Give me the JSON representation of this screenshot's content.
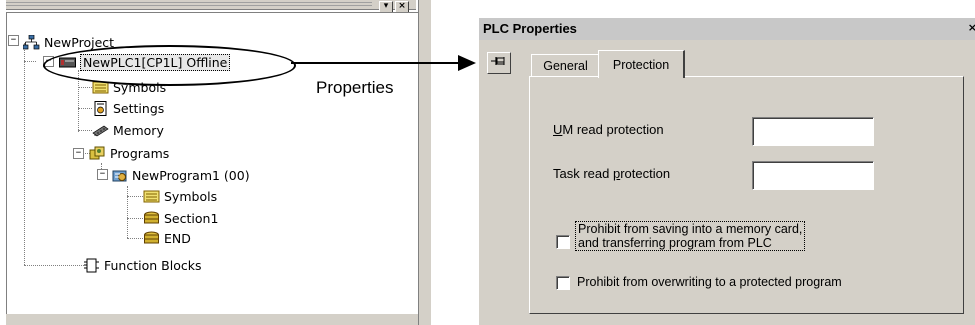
{
  "tree": {
    "items": [
      {
        "label": "NewProject"
      },
      {
        "label": "NewPLC1[CP1L] Offline"
      },
      {
        "label": "Symbols"
      },
      {
        "label": "Settings"
      },
      {
        "label": "Memory"
      },
      {
        "label": "Programs"
      },
      {
        "label": "NewProgram1 (00)"
      },
      {
        "label": "Symbols"
      },
      {
        "label": "Section1"
      },
      {
        "label": "END"
      },
      {
        "label": "Function Blocks"
      }
    ]
  },
  "callout": {
    "label": "Properties"
  },
  "dialog": {
    "title": "PLC Properties",
    "tabs": [
      {
        "label": "General"
      },
      {
        "label": "Protection",
        "selected": true
      }
    ],
    "fields": [
      {
        "label": "UM read protection",
        "mnemonic": "U",
        "value": ""
      },
      {
        "label": "Task read protection",
        "mnemonic": "p",
        "value": ""
      }
    ],
    "checkboxes": [
      {
        "line1": "Prohibit from saving into a memory card,",
        "line2": "and transferring program from PLC",
        "checked": false
      },
      {
        "label": "Prohibit from overwriting to a protected program",
        "checked": false
      }
    ]
  },
  "icons": [
    "tree-icon",
    "plc-icon",
    "symbols-icon",
    "settings-icon",
    "memory-icon",
    "programs-icon",
    "program-icon",
    "section-icon",
    "function-blocks-icon",
    "pin-icon",
    "close-icon"
  ]
}
